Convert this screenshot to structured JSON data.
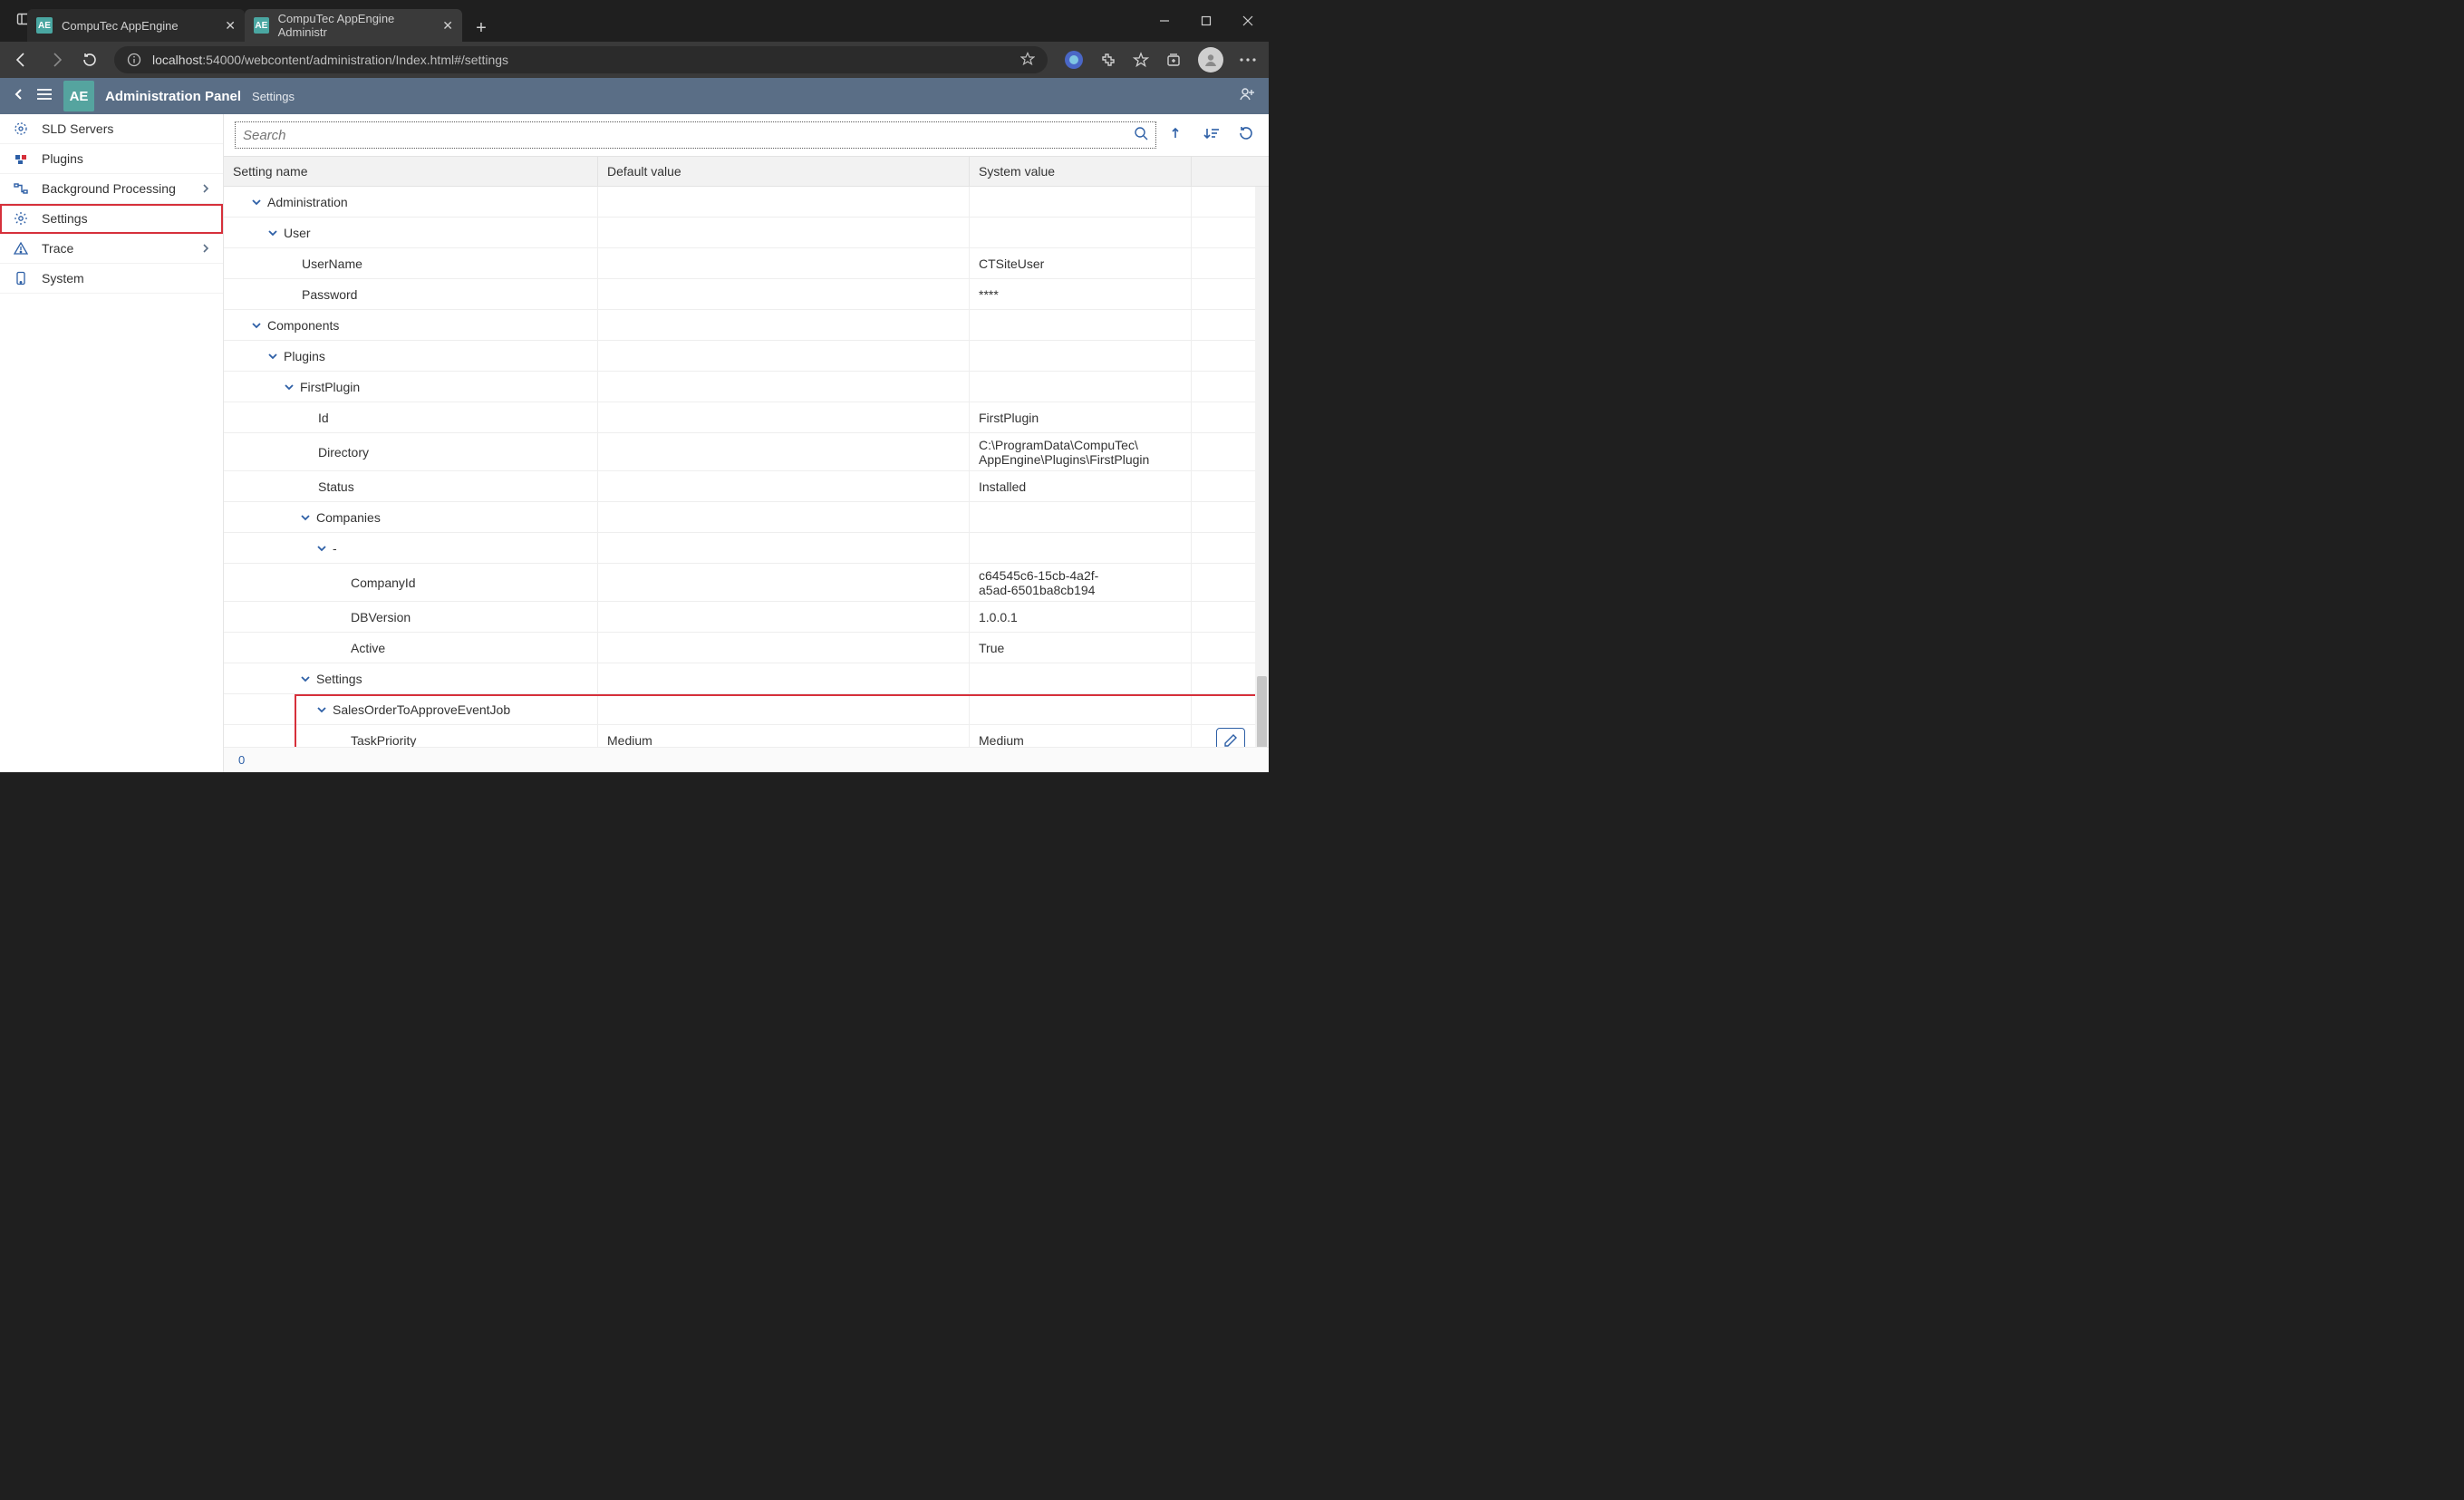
{
  "browser": {
    "tabs": [
      {
        "title": "CompuTec AppEngine",
        "active": false
      },
      {
        "title": "CompuTec AppEngine Administr",
        "active": true
      }
    ],
    "url_host": "localhost",
    "url_path": ":54000/webcontent/administration/Index.html#/settings"
  },
  "app": {
    "logo": "AE",
    "title": "Administration Panel",
    "subtitle": "Settings"
  },
  "sidebar": {
    "items": [
      {
        "label": "SLD Servers",
        "icon": "gear-cluster",
        "expandable": false
      },
      {
        "label": "Plugins",
        "icon": "plugin",
        "expandable": false
      },
      {
        "label": "Background Processing",
        "icon": "flow",
        "expandable": true
      },
      {
        "label": "Settings",
        "icon": "settings",
        "expandable": false,
        "selected": true
      },
      {
        "label": "Trace",
        "icon": "warning",
        "expandable": true
      },
      {
        "label": "System",
        "icon": "device",
        "expandable": false
      }
    ]
  },
  "toolbar": {
    "search_placeholder": "Search"
  },
  "grid": {
    "headers": {
      "c1": "Setting name",
      "c2": "Default value",
      "c3": "System value"
    },
    "rows": [
      {
        "type": "group",
        "indent": 0,
        "name": "Administration"
      },
      {
        "type": "group",
        "indent": 1,
        "name": "User"
      },
      {
        "type": "leaf",
        "indent": 0,
        "name": "UserName",
        "sys": "CTSiteUser"
      },
      {
        "type": "leaf",
        "indent": 0,
        "name": "Password",
        "sys": "****"
      },
      {
        "type": "group",
        "indent": 0,
        "name": "Components"
      },
      {
        "type": "group",
        "indent": 1,
        "name": "Plugins"
      },
      {
        "type": "group",
        "indent": 2,
        "name": "FirstPlugin"
      },
      {
        "type": "leaf",
        "indent": 1,
        "name": "Id",
        "sys": "FirstPlugin"
      },
      {
        "type": "leaf",
        "indent": 1,
        "name": "Directory",
        "sys": "C:\\ProgramData\\CompuTec\\AppEngine\\Plugins\\FirstPlugin",
        "tall": true
      },
      {
        "type": "leaf",
        "indent": 1,
        "name": "Status",
        "sys": "Installed"
      },
      {
        "type": "group",
        "indent": 3,
        "name": "Companies"
      },
      {
        "type": "group",
        "indent": 4,
        "name": "-"
      },
      {
        "type": "leaf",
        "indent": 2,
        "name": "CompanyId",
        "sys": "c64545c6-15cb-4a2f-a5ad-6501ba8cb194",
        "tall": true
      },
      {
        "type": "leaf",
        "indent": 2,
        "name": "DBVersion",
        "sys": "1.0.0.1"
      },
      {
        "type": "leaf",
        "indent": 2,
        "name": "Active",
        "sys": "True"
      },
      {
        "type": "group",
        "indent": 3,
        "name": "Settings"
      },
      {
        "type": "group",
        "indent": 4,
        "name": "SalesOrderToApproveEventJob",
        "hl": true
      },
      {
        "type": "leaf",
        "indent": 2,
        "name": "TaskPriority",
        "def": "Medium",
        "sys": "Medium",
        "edit": true,
        "hl": true
      }
    ]
  },
  "footer": {
    "count": "0"
  }
}
